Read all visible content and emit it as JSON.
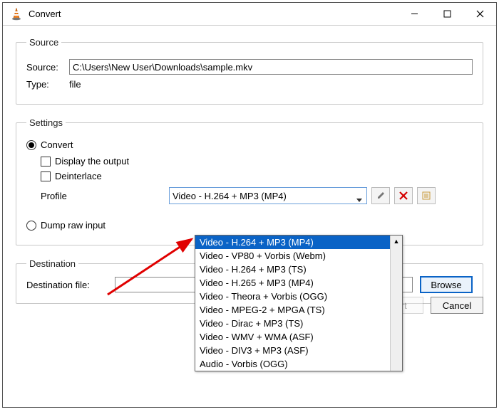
{
  "window": {
    "title": "Convert"
  },
  "source_group": {
    "legend": "Source",
    "source_label": "Source:",
    "source_value": "C:\\Users\\New User\\Downloads\\sample.mkv",
    "type_label": "Type:",
    "type_value": "file"
  },
  "settings_group": {
    "legend": "Settings",
    "convert_label": "Convert",
    "display_label": "Display the output",
    "deinterlace_label": "Deinterlace",
    "profile_label": "Profile",
    "profile_value": "Video - H.264 + MP3 (MP4)",
    "profile_options": [
      "Video - H.264 + MP3 (MP4)",
      "Video - VP80 + Vorbis (Webm)",
      "Video - H.264 + MP3 (TS)",
      "Video - H.265 + MP3 (MP4)",
      "Video - Theora + Vorbis (OGG)",
      "Video - MPEG-2 + MPGA (TS)",
      "Video - Dirac + MP3 (TS)",
      "Video - WMV + WMA (ASF)",
      "Video - DIV3 + MP3 (ASF)",
      "Audio - Vorbis (OGG)"
    ],
    "dump_label": "Dump raw input"
  },
  "destination_group": {
    "legend": "Destination",
    "dest_label": "Destination file:",
    "browse_label": "Browse"
  },
  "footer": {
    "start_label": "Start",
    "cancel_label": "Cancel"
  },
  "icons": {
    "wrench": "wrench-icon",
    "delete": "x-icon",
    "new": "new-profile-icon"
  },
  "colors": {
    "accent": "#0a63c6",
    "danger": "#d40000"
  }
}
